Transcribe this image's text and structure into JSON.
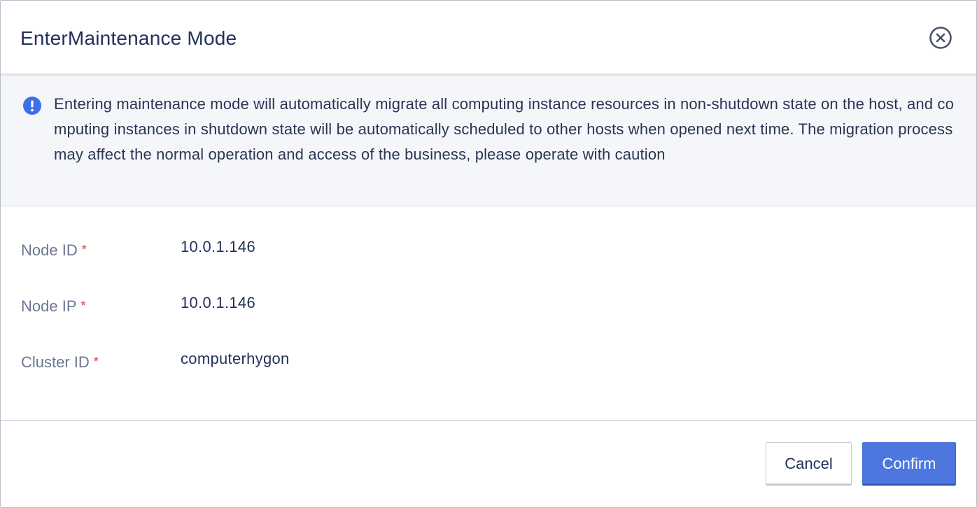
{
  "dialog": {
    "title": "EnterMaintenance Mode",
    "close_icon": "close-circle-icon"
  },
  "alert": {
    "icon": "info-circle-icon",
    "color": "#3e6ee8",
    "message": "Entering maintenance mode will automatically migrate all computing instance resources in non-shutdown state on the host, and computing instances in shutdown state will be automatically scheduled to other hosts when opened next time. The migration process may affect the normal operation and access of the business, please operate with caution"
  },
  "form": {
    "fields": [
      {
        "label": "Node ID",
        "required_mark": "*",
        "value": "10.0.1.146"
      },
      {
        "label": "Node IP",
        "required_mark": "*",
        "value": "10.0.1.146"
      },
      {
        "label": "Cluster ID",
        "required_mark": "*",
        "value": "computerhygon"
      }
    ]
  },
  "footer": {
    "cancel_label": "Cancel",
    "confirm_label": "Confirm"
  },
  "colors": {
    "primary": "#4d76df",
    "required": "#e0413b",
    "title": "#23315a"
  }
}
